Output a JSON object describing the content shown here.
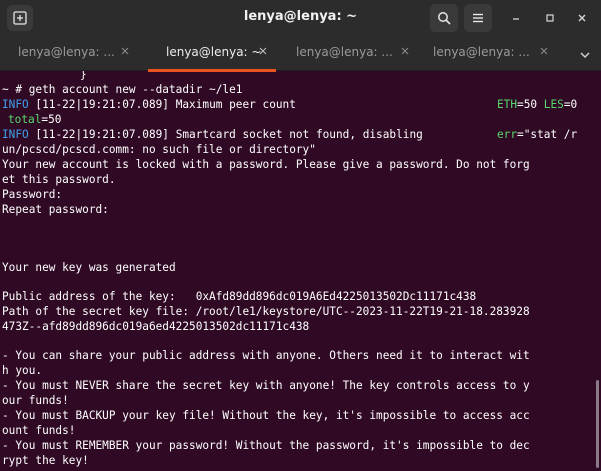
{
  "window": {
    "title": "lenya@lenya: ~",
    "icons": {
      "new_tab": "new-tab-icon",
      "search": "search-icon",
      "menu": "hamburger-menu-icon",
      "minimize": "minimize-icon",
      "maximize": "maximize-icon",
      "close": "close-icon"
    }
  },
  "tabs": [
    {
      "label": "lenya@lenya: ...",
      "active": false
    },
    {
      "label": "lenya@lenya: ~",
      "active": true
    },
    {
      "label": "lenya@lenya: ...",
      "active": false
    },
    {
      "label": "lenya@lenya: ...",
      "active": false
    }
  ],
  "tab_overflow_icon": "chevron-down-icon",
  "terminal": {
    "l0": "}",
    "l1": "~ # geth account new --datadir ~/le1",
    "l2": {
      "level": "INFO",
      "time": "[11-22|19:21:07.089]",
      "msg": "Maximum peer count",
      "k1": "ETH",
      "v1": "=50",
      "k2": "LES",
      "v2": "=0"
    },
    "l3": {
      "k": "total",
      "v": "=50"
    },
    "l4": {
      "level": "INFO",
      "time": "[11-22|19:21:07.089]",
      "msg": "Smartcard socket not found, disabling",
      "k": "err",
      "v": "=\"stat /r"
    },
    "l5": "un/pcscd/pcscd.comm: no such file or directory\"",
    "l6": "Your new account is locked with a password. Please give a password. Do not forg",
    "l7": "et this password.",
    "l8": "Password:",
    "l9": "Repeat password:",
    "l10": "Your new key was generated",
    "l11": "Public address of the key:   0xAfd89dd896dc019A6Ed4225013502Dc11171c438",
    "l12": "Path of the secret key file: /root/le1/keystore/UTC--2023-11-22T19-21-18.283928",
    "l13": "473Z--afd89dd896dc019a6ed4225013502dc11171c438",
    "l14": "- You can share your public address with anyone. Others need it to interact wit",
    "l15": "h you.",
    "l16": "- You must NEVER share the secret key with anyone! The key controls access to y",
    "l17": "our funds!",
    "l18": "- You must BACKUP your key file! Without the key, it's impossible to access acc",
    "l19": "ount funds!",
    "l20": "- You must REMEMBER your password! Without the password, it's impossible to dec",
    "l21": "rypt the key!"
  },
  "colors": {
    "terminal_bg": "#300a24",
    "info_level": "#3f9fea",
    "log_key": "#57d66b",
    "active_tab_indicator": "#e95420"
  }
}
